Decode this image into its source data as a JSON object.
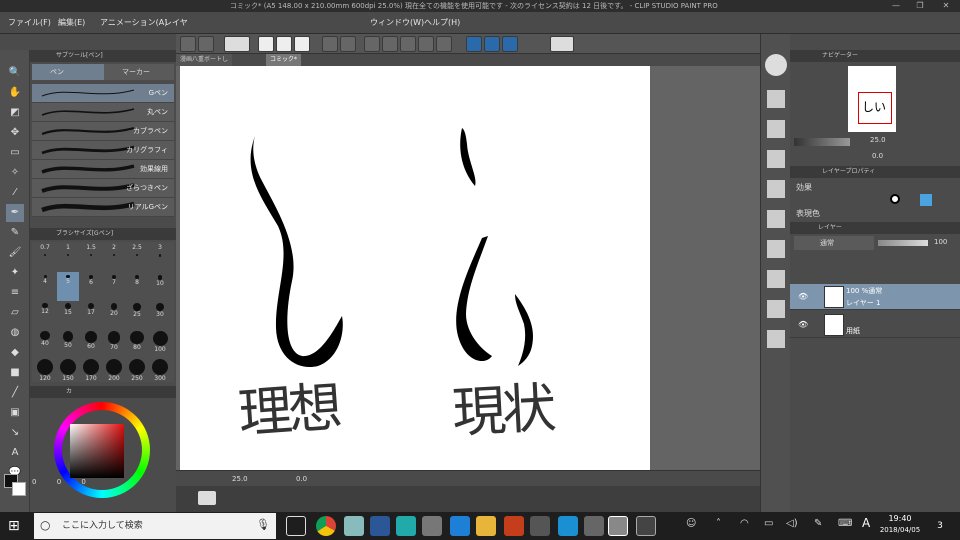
{
  "window": {
    "title": "コミック* (A5 148.00 x 210.00mm 600dpi 25.0%)  現在全ての機能を使用可能です - 次のライセンス契約は 12 日後です。 - CLIP STUDIO PAINT PRO"
  },
  "menu": [
    "ファイル(F)",
    "編集(E)",
    "アニメーション(A)",
    "レイヤ",
    "ウィンドウ(W)",
    "ヘルプ(H)"
  ],
  "sub_tool_panel": {
    "title": "サブツール[ペン]",
    "tabs": [
      "ペン",
      "マーカー"
    ],
    "brushes": [
      "Gペン",
      "丸ペン",
      "カブラペン",
      "カリグラフィ",
      "効果線用",
      "ざらつきペン",
      "リアルGペン"
    ]
  },
  "brush_size_panel": {
    "title": "ブラシサイズ[Gペン]",
    "sizes": [
      "0.7",
      "1",
      "1.5",
      "2",
      "2.5",
      "3",
      "4",
      "5",
      "6",
      "7",
      "8",
      "10",
      "12",
      "15",
      "17",
      "20",
      "25",
      "30",
      "40",
      "50",
      "60",
      "70",
      "80",
      "100",
      "120",
      "150",
      "170",
      "200",
      "250",
      "300"
    ]
  },
  "color_panel": {
    "title": "カ",
    "values": [
      "0",
      "0",
      "0"
    ]
  },
  "tabs": [
    "漫画八重ボートし",
    "コミック*"
  ],
  "canvas": {
    "text_left": "理想",
    "text_right": "現状"
  },
  "statusbar": {
    "zoom": "25.0",
    "angle": "0.0"
  },
  "navigator": {
    "title": "ナビゲーター",
    "zoom": "25.0",
    "angle": "0.0"
  },
  "layer_property": {
    "title": "レイヤープロパティ",
    "effect_label": "効果",
    "color_label": "表現色"
  },
  "layer_panel": {
    "tab": "レイヤー",
    "blend": "通常",
    "opacity": "100",
    "layers": [
      {
        "mode": "100 %通常",
        "name": "レイヤー 1"
      },
      {
        "mode": "",
        "name": "用紙"
      }
    ]
  },
  "taskbar": {
    "search_placeholder": "ここに入力して検索",
    "time": "19:40",
    "date": "2018/04/05",
    "ime": "A",
    "notify": "3"
  },
  "colors": {
    "accent": "#8fb3d1",
    "selected_layer": "#7d96ad"
  }
}
